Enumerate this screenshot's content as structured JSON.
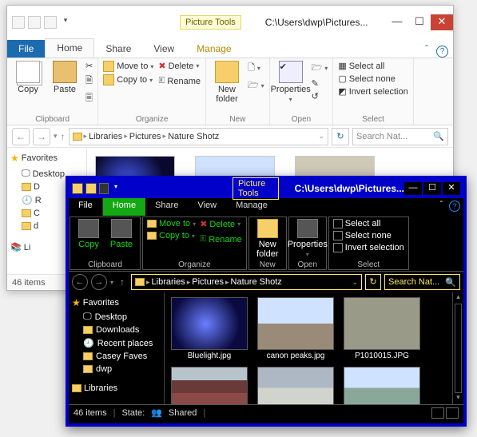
{
  "winA": {
    "context_tab": "Picture Tools",
    "title": "C:\\Users\\dwp\\Pictures...",
    "tabs": {
      "file": "File",
      "home": "Home",
      "share": "Share",
      "view": "View",
      "manage": "Manage"
    },
    "ribbon": {
      "clipboard": {
        "label": "Clipboard",
        "copy": "Copy",
        "paste": "Paste"
      },
      "organize": {
        "label": "Organize",
        "moveto": "Move to",
        "copyto": "Copy to",
        "delete": "Delete",
        "rename": "Rename"
      },
      "new": {
        "label": "New",
        "newfolder": "New\nfolder"
      },
      "open": {
        "label": "Open",
        "properties": "Properties"
      },
      "select": {
        "label": "Select",
        "all": "Select all",
        "none": "Select none",
        "invert": "Invert selection"
      }
    },
    "crumbs": [
      "Libraries",
      "Pictures",
      "Nature Shotz"
    ],
    "search_placeholder": "Search Nat...",
    "sidebar": {
      "favorites": "Favorites",
      "items": [
        "Desktop",
        "D",
        "R",
        "C",
        "d"
      ],
      "libraries_short": "Li"
    },
    "status": {
      "count": "46 items"
    }
  },
  "winB": {
    "context_tab": "Picture Tools",
    "title": "C:\\Users\\dwp\\Pictures...",
    "tabs": {
      "file": "File",
      "home": "Home",
      "share": "Share",
      "view": "View",
      "manage": "Manage"
    },
    "ribbon": {
      "clipboard": {
        "label": "Clipboard",
        "copy": "Copy",
        "paste": "Paste"
      },
      "organize": {
        "label": "Organize",
        "moveto": "Move to",
        "copyto": "Copy to",
        "delete": "Delete",
        "rename": "Rename"
      },
      "new": {
        "label": "New",
        "newfolder": "New\nfolder"
      },
      "open": {
        "label": "Open",
        "properties": "Properties"
      },
      "select": {
        "label": "Select",
        "all": "Select all",
        "none": "Select none",
        "invert": "Invert selection"
      }
    },
    "crumbs": [
      "Libraries",
      "Pictures",
      "Nature Shotz"
    ],
    "search_placeholder": "Search Nat...",
    "sidebar": {
      "favorites": "Favorites",
      "items": [
        "Desktop",
        "Downloads",
        "Recent places",
        "Casey Faves",
        "dwp"
      ],
      "libraries": "Libraries"
    },
    "files": [
      "Bluelight.jpg",
      "canon peaks.jpg",
      "P1010015.JPG"
    ],
    "status": {
      "count": "46 items",
      "state_label": "State:",
      "state_value": "Shared"
    }
  }
}
